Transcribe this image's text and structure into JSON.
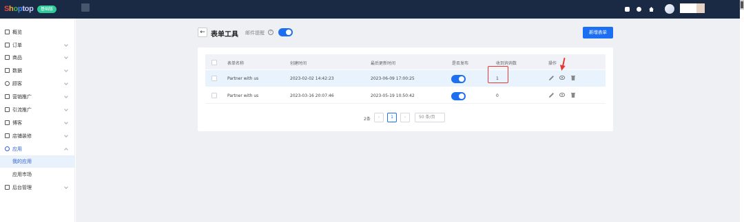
{
  "app": {
    "logo_parts": [
      "S",
      "h",
      "o",
      "p",
      "top"
    ],
    "edition_badge": "基础版"
  },
  "sidebar": {
    "items": [
      {
        "label": "概览"
      },
      {
        "label": "订单"
      },
      {
        "label": "商品"
      },
      {
        "label": "数据"
      },
      {
        "label": "顾客"
      },
      {
        "label": "营销推广"
      },
      {
        "label": "引流推广"
      },
      {
        "label": "博客"
      },
      {
        "label": "店铺装修"
      },
      {
        "label": "应用"
      },
      {
        "label": "后台管理"
      }
    ],
    "sub_items": [
      {
        "label": "我的应用"
      },
      {
        "label": "应用市场"
      }
    ]
  },
  "header": {
    "back_glyph": "←",
    "title": "表单工具",
    "mail_label": "邮件提醒",
    "help_glyph": "?",
    "new_button": "新增表单"
  },
  "table": {
    "columns": [
      "表单名称",
      "创建时间",
      "最后更新时间",
      "是否发布",
      "收到询询数",
      "操作"
    ],
    "rows": [
      {
        "name": "Partner with us",
        "created": "2023-02-02 14:42:23",
        "updated": "2023-06-09 17:00:25",
        "published": true,
        "count": "1"
      },
      {
        "name": "Partner with us",
        "created": "2023-03-16 20:07:46",
        "updated": "2023-05-19 10:50:42",
        "published": true,
        "count": "0"
      }
    ]
  },
  "pagination": {
    "total": "2条",
    "prev": "‹",
    "current": "1",
    "next": "›",
    "page_size": "50 条/页"
  },
  "colors": {
    "topbar": "#1b2a44",
    "primary": "#1d6ff2",
    "annotation": "#e53935"
  }
}
